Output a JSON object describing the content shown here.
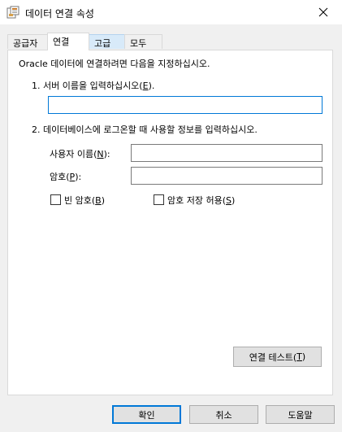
{
  "window": {
    "title": "데이터 연결 속성",
    "icon": "data-link-icon",
    "close_icon": "close-icon"
  },
  "tabs": [
    {
      "label": "공급자"
    },
    {
      "label": "연결"
    },
    {
      "label": "고급"
    },
    {
      "label": "모두"
    }
  ],
  "connection": {
    "intro": "Oracle 데이터에 연결하려면 다음을 지정하십시오.",
    "step1_prefix": "1. 서버 이름을 입력하십시오(",
    "step1_key": "E",
    "step1_suffix": ").",
    "server_name_value": "",
    "step2": "2. 데이터베이스에 로그온할 때 사용할 정보를 입력하십시오.",
    "username_prefix": "사용자 이름(",
    "username_key": "N",
    "username_suffix": "):",
    "username_value": "",
    "password_prefix": "암호(",
    "password_key": "P",
    "password_suffix": "):",
    "password_value": "",
    "blank_password_prefix": "빈 암호(",
    "blank_password_key": "B",
    "blank_password_suffix": ")",
    "blank_password_checked": false,
    "allow_save_prefix": "암호 저장 허용(",
    "allow_save_key": "S",
    "allow_save_suffix": ")",
    "allow_save_checked": false,
    "test_prefix": "연결 테스트(",
    "test_key": "T",
    "test_suffix": ")"
  },
  "footer": {
    "ok": "확인",
    "cancel": "취소",
    "help": "도움말"
  },
  "colors": {
    "accent": "#0078d7",
    "hover_tab": "#d8eaf9"
  }
}
